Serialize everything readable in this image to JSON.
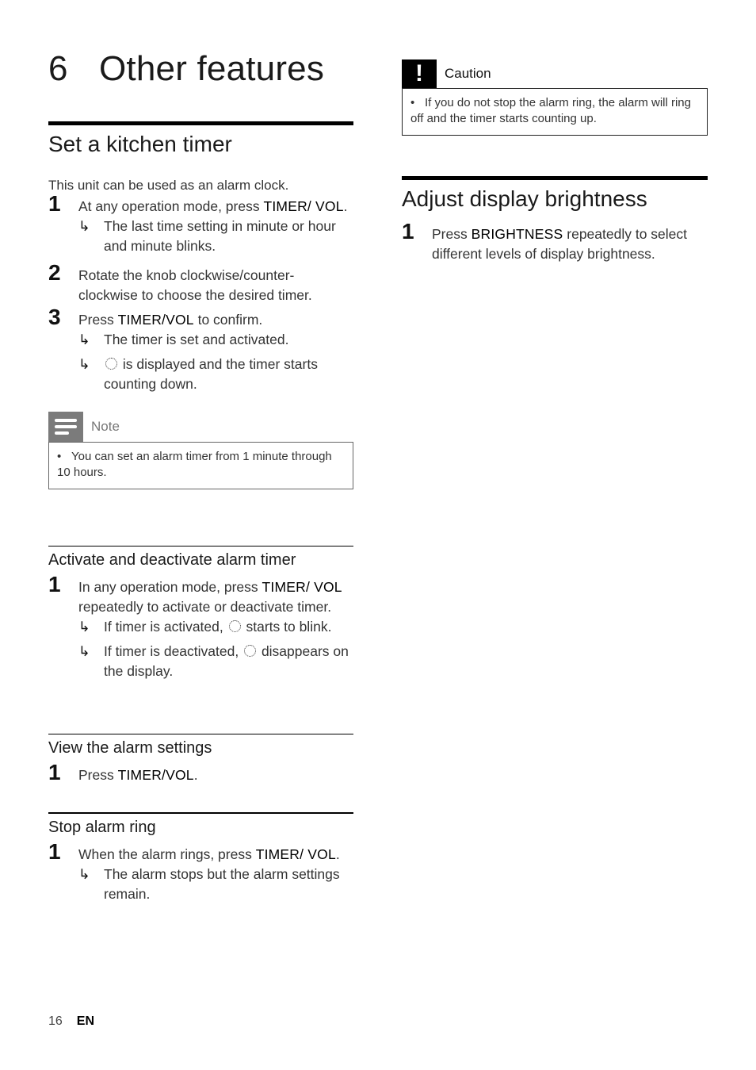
{
  "chapter": {
    "number": "6",
    "title": "Other features"
  },
  "kitchen_timer": {
    "heading": "Set a kitchen timer",
    "intro": "This unit can be used as an alarm clock.",
    "steps": [
      {
        "n": "1",
        "pre": "At any operation mode, press ",
        "key": "TIMER/ VOL",
        "post": ".",
        "results": [
          "The last time setting in minute or hour and minute blinks."
        ]
      },
      {
        "n": "2",
        "pre": "Rotate the knob clockwise/counter-clockwise to choose the desired timer.",
        "key": "",
        "post": "",
        "results": []
      },
      {
        "n": "3",
        "pre": "Press ",
        "key": "TIMER/VOL",
        "post": " to confirm.",
        "results": [
          "The timer is set and activated."
        ],
        "result_icon": {
          "icon": "timer-clock-icon",
          "text": " is displayed and the timer starts counting down."
        }
      }
    ],
    "note": {
      "label": "Note",
      "icon": "note-lines-icon",
      "bullet": "•",
      "text": "You can set an alarm timer from 1 minute through 10 hours."
    }
  },
  "activate": {
    "heading": "Activate and deactivate alarm timer",
    "step": {
      "n": "1",
      "pre": "In any operation mode, press ",
      "key": "TIMER/ VOL",
      "post": " repeatedly to activate or deactivate timer."
    },
    "results": [
      {
        "pre": "If timer is activated, ",
        "post": " starts to blink."
      },
      {
        "pre": "If timer is deactivated, ",
        "post": " disappears on the display."
      }
    ]
  },
  "view": {
    "heading": "View the alarm settings",
    "step": {
      "n": "1",
      "pre": "Press ",
      "key": "TIMER/VOL",
      "post": "."
    }
  },
  "stop": {
    "heading": "Stop alarm ring",
    "step": {
      "n": "1",
      "pre": "When the alarm rings, press ",
      "key": "TIMER/ VOL",
      "post": "."
    },
    "result": "The alarm stops but the alarm settings remain."
  },
  "caution": {
    "label": "Caution",
    "icon_glyph": "!",
    "bullet": "•",
    "text": "If you do not stop the alarm ring, the alarm will ring off and the timer starts counting up."
  },
  "brightness": {
    "heading": "Adjust display brightness",
    "step": {
      "n": "1",
      "pre": "Press ",
      "key": "BRIGHTNESS",
      "post": " repeatedly to select different levels of display brightness."
    }
  },
  "arrow_glyph": "↳",
  "timer_glyph": "⏱",
  "footer": {
    "page": "16",
    "lang": "EN"
  }
}
